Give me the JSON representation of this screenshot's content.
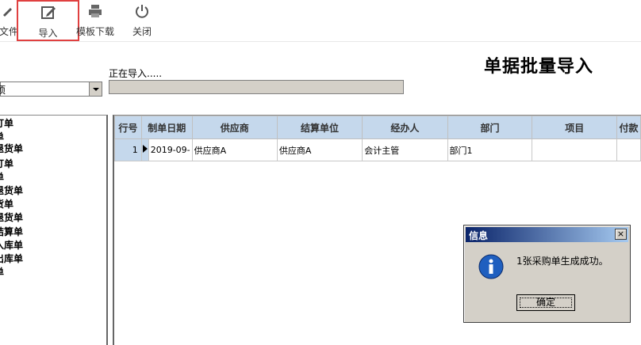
{
  "toolbar": {
    "file_label": "文件",
    "import_label": "导入",
    "template_label": "模板下载",
    "close_label": "关闭"
  },
  "page": {
    "title": "单据批量导入",
    "status": "正在导入.....",
    "progress_fraction": 0.0
  },
  "combo": {
    "value": "项"
  },
  "left_list": [
    "订单",
    "单",
    "退货单",
    "订单",
    "单",
    "退货单",
    "货单",
    "退货单",
    "结算单",
    "入库单",
    "出库单",
    "单"
  ],
  "grid": {
    "columns": [
      "行号",
      "制单日期",
      "供应商",
      "结算单位",
      "经办人",
      "部门",
      "项目",
      "付款"
    ],
    "rows": [
      {
        "no": "1",
        "date": "2019-09-",
        "supplier": "供应商A",
        "settle": "供应商A",
        "handler": "会计主管",
        "dept": "部门1",
        "project": "",
        "pay": ""
      }
    ]
  },
  "dialog": {
    "title": "信息",
    "close": "×",
    "message": "1张采购单生成成功。",
    "ok_label": "确定"
  },
  "colors": {
    "header_bg": "#c5d8ec",
    "import_highlight": "#e04040",
    "dialog_title": "#0a246a"
  },
  "icons": [
    "pencil-icon",
    "edit-icon",
    "printer-icon",
    "power-icon",
    "info-icon"
  ]
}
